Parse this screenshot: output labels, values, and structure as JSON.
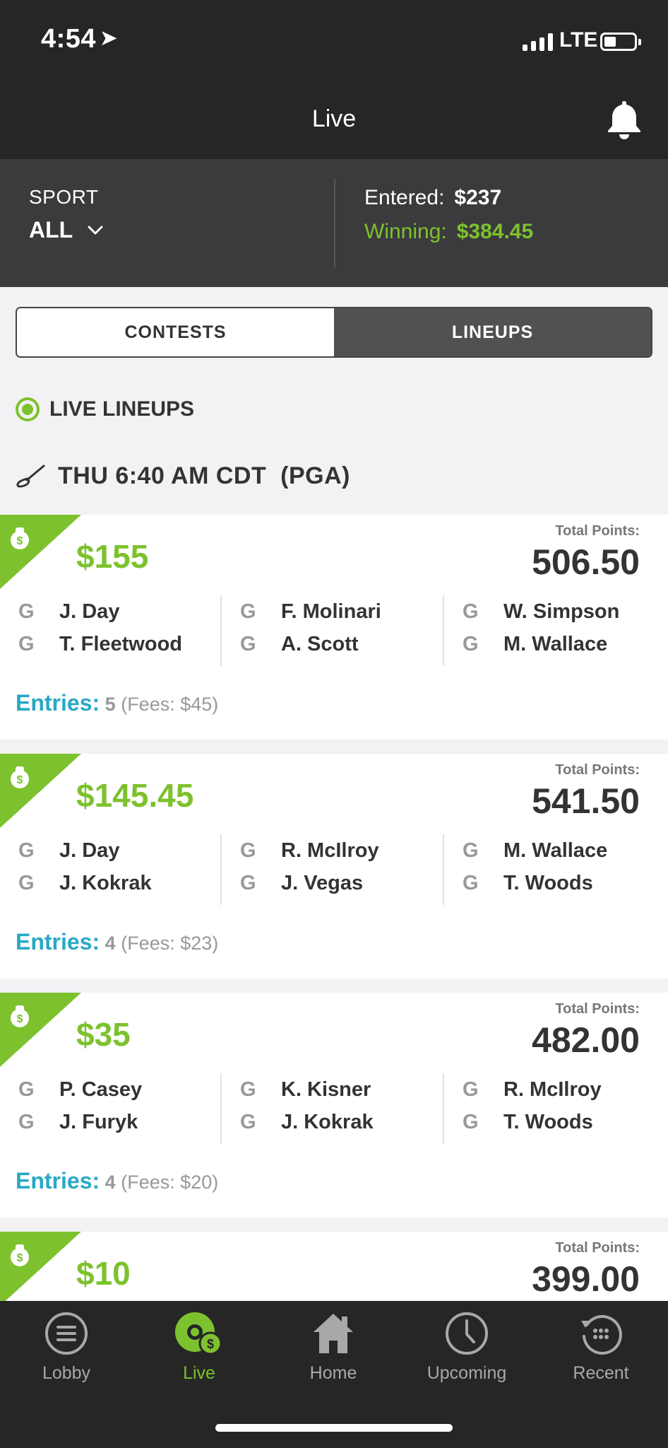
{
  "status_bar": {
    "time": "4:54",
    "network": "LTE"
  },
  "nav": {
    "title": "Live"
  },
  "summary": {
    "sport_label": "SPORT",
    "sport_value": "ALL",
    "entered_label": "Entered:",
    "entered_value": "$237",
    "winning_label": "Winning:",
    "winning_value": "$384.45"
  },
  "tabs": {
    "contests": "CONTESTS",
    "lineups": "LINEUPS",
    "selected": "LINEUPS"
  },
  "live_header": "LIVE LINEUPS",
  "event_header": "THU 6:40 AM CDT  (PGA)",
  "cards": [
    {
      "prize": "$155",
      "total_points_label": "Total Points:",
      "total_points": "506.50",
      "players": [
        {
          "pos": "G",
          "name": "J. Day"
        },
        {
          "pos": "G",
          "name": "T. Fleetwood"
        },
        {
          "pos": "G",
          "name": "F. Molinari"
        },
        {
          "pos": "G",
          "name": "A. Scott"
        },
        {
          "pos": "G",
          "name": "W. Simpson"
        },
        {
          "pos": "G",
          "name": "M. Wallace"
        }
      ],
      "entries_label": "Entries:",
      "entries_count": "5",
      "fees": "(Fees: $45)"
    },
    {
      "prize": "$145.45",
      "total_points_label": "Total Points:",
      "total_points": "541.50",
      "players": [
        {
          "pos": "G",
          "name": "J. Day"
        },
        {
          "pos": "G",
          "name": "J. Kokrak"
        },
        {
          "pos": "G",
          "name": "R. McIlroy"
        },
        {
          "pos": "G",
          "name": "J. Vegas"
        },
        {
          "pos": "G",
          "name": "M. Wallace"
        },
        {
          "pos": "G",
          "name": "T. Woods"
        }
      ],
      "entries_label": "Entries:",
      "entries_count": "4",
      "fees": "(Fees: $23)"
    },
    {
      "prize": "$35",
      "total_points_label": "Total Points:",
      "total_points": "482.00",
      "players": [
        {
          "pos": "G",
          "name": "P. Casey"
        },
        {
          "pos": "G",
          "name": "J. Furyk"
        },
        {
          "pos": "G",
          "name": "K. Kisner"
        },
        {
          "pos": "G",
          "name": "J. Kokrak"
        },
        {
          "pos": "G",
          "name": "R. McIlroy"
        },
        {
          "pos": "G",
          "name": "T. Woods"
        }
      ],
      "entries_label": "Entries:",
      "entries_count": "4",
      "fees": "(Fees: $20)"
    },
    {
      "prize": "$10",
      "total_points_label": "Total Points:",
      "total_points": "399.00"
    }
  ],
  "tabbar": [
    {
      "label": "Lobby",
      "icon": "menu-circle-icon"
    },
    {
      "label": "Live",
      "icon": "live-money-icon",
      "active": true
    },
    {
      "label": "Home",
      "icon": "home-icon"
    },
    {
      "label": "Upcoming",
      "icon": "clock-icon"
    },
    {
      "label": "Recent",
      "icon": "history-icon"
    }
  ],
  "colors": {
    "accent_green": "#7dc22e",
    "entries_blue": "#2aa8c4",
    "bar_dark": "#262626",
    "summary_bg": "#3b3b3d"
  }
}
